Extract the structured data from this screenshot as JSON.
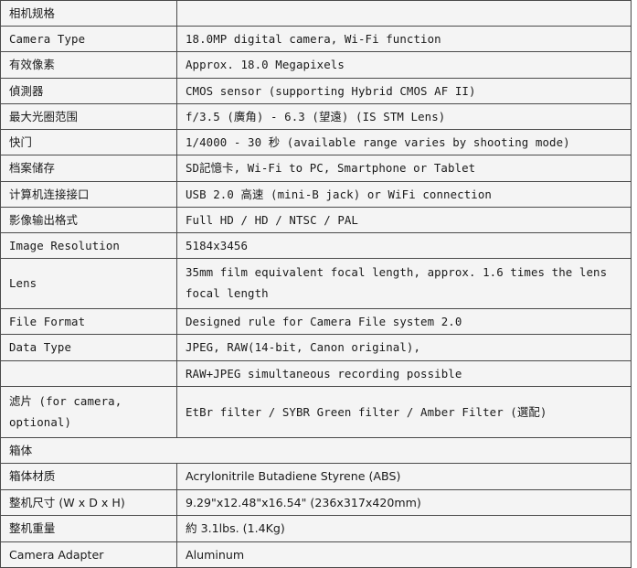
{
  "table": {
    "columns": [
      "spec_name",
      "spec_value"
    ],
    "rows": [
      {
        "label": "相机规格",
        "value": "",
        "style": "mono",
        "type": "section-header"
      },
      {
        "label": "Camera Type",
        "value": "18.0MP digital camera, Wi-Fi function",
        "style": "mono",
        "type": "data"
      },
      {
        "label": "有效像素",
        "value": "Approx. 18.0 Megapixels",
        "style": "mono",
        "type": "data"
      },
      {
        "label": "偵測器",
        "value": "CMOS sensor (supporting Hybrid CMOS AF II)",
        "style": "mono",
        "type": "data"
      },
      {
        "label": "最大光圈范围",
        "value": "f/3.5 (廣角) - 6.3 (望遠) (IS STM Lens)",
        "style": "mono",
        "type": "data"
      },
      {
        "label": "快门",
        "value": "1/4000 - 30 秒 (available range varies by shooting mode)",
        "style": "mono",
        "type": "data"
      },
      {
        "label": "档案储存",
        "value": "SD記憶卡, Wi-Fi to PC, Smartphone or Tablet",
        "style": "mono",
        "type": "data"
      },
      {
        "label": "计算机连接接口",
        "value": "USB 2.0 高速 (mini-B jack) or WiFi connection",
        "style": "mono",
        "type": "data"
      },
      {
        "label": "影像输出格式",
        "value": "Full HD / HD / NTSC / PAL",
        "style": "mono",
        "type": "data"
      },
      {
        "label": "Image Resolution",
        "value": "5184x3456",
        "style": "mono",
        "type": "data"
      },
      {
        "label": "Lens",
        "value": "35mm film equivalent focal length, approx. 1.6 times the lens focal length",
        "style": "mono",
        "type": "data-tall"
      },
      {
        "label": "File Format",
        "value": "Designed rule for Camera File system 2.0",
        "style": "mono",
        "type": "data"
      },
      {
        "label": "Data Type",
        "value": "JPEG, RAW(14-bit, Canon original),",
        "style": "mono",
        "type": "data"
      },
      {
        "label": "",
        "value": "RAW+JPEG simultaneous recording possible",
        "style": "mono",
        "type": "data"
      },
      {
        "label": "滤片 (for camera, optional)",
        "value": "EtBr filter / SYBR Green filter / Amber Filter (選配)",
        "style": "mono",
        "type": "data-filter"
      },
      {
        "label": "箱体",
        "value": "",
        "style": "sans",
        "type": "section-header-merged"
      },
      {
        "label": "箱体材质",
        "value": "Acrylonitrile Butadiene Styrene (ABS)",
        "style": "sans",
        "type": "data"
      },
      {
        "label": "整机尺寸 (W x D x H)",
        "value": "9.29\"x12.48\"x16.54\" (236x317x420mm)",
        "style": "sans",
        "type": "data"
      },
      {
        "label": "整机重量",
        "value": "約 3.1lbs. (1.4Kg)",
        "style": "sans",
        "type": "data"
      },
      {
        "label": "Camera Adapter",
        "value": "Aluminum",
        "style": "sans",
        "type": "data"
      }
    ]
  },
  "colors": {
    "cell_background": "#f4f4f4",
    "border": "#4a4a4a",
    "text": "#1a1a1a",
    "page_background": "#ffffff"
  }
}
